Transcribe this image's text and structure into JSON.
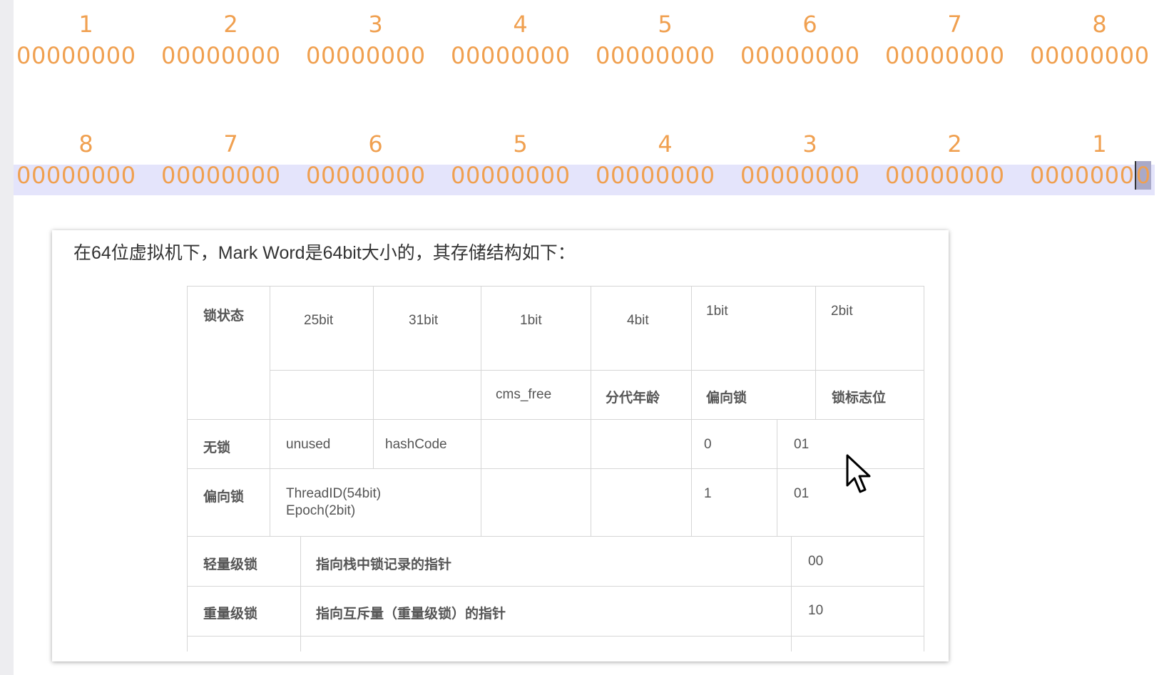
{
  "row1": {
    "labels": [
      "1",
      "2",
      "3",
      "4",
      "5",
      "6",
      "7",
      "8"
    ],
    "bytes": [
      "00000000",
      "00000000",
      "00000000",
      "00000000",
      "00000000",
      "00000000",
      "00000000",
      "00000000"
    ]
  },
  "row2": {
    "labels": [
      "8",
      "7",
      "6",
      "5",
      "4",
      "3",
      "2",
      "1"
    ],
    "bytes": [
      "00000000",
      "00000000",
      "00000000",
      "00000000",
      "00000000",
      "00000000",
      "00000000",
      "0000000"
    ],
    "cursor_char": "0"
  },
  "card": {
    "title": "在64位虚拟机下，Mark Word是64bit大小的，其存储结构如下：",
    "table": {
      "header_state": "锁状态",
      "h_25bit": "25bit",
      "h_31bit": "31bit",
      "h_1bit_a": "1bit",
      "h_4bit": "4bit",
      "h_1bit_b": "1bit",
      "h_2bit": "2bit",
      "sub_cms_free": "cms_free",
      "sub_age": "分代年龄",
      "sub_biased": "偏向锁",
      "sub_flag": "锁标志位",
      "r_nolock": {
        "name": "无锁",
        "c1": "unused",
        "c2": "hashCode",
        "c5": "0",
        "c6": "01"
      },
      "r_biased": {
        "name": "偏向锁",
        "c1a": "ThreadID(54bit)",
        "c1b": "Epoch(2bit)",
        "c5": "1",
        "c6": "01"
      },
      "r_light": {
        "name": "轻量级锁",
        "desc": "指向栈中锁记录的指针",
        "flag": "00"
      },
      "r_heavy": {
        "name": "重量级锁",
        "desc": "指向互斥量（重量级锁）的指针",
        "flag": "10"
      }
    }
  }
}
